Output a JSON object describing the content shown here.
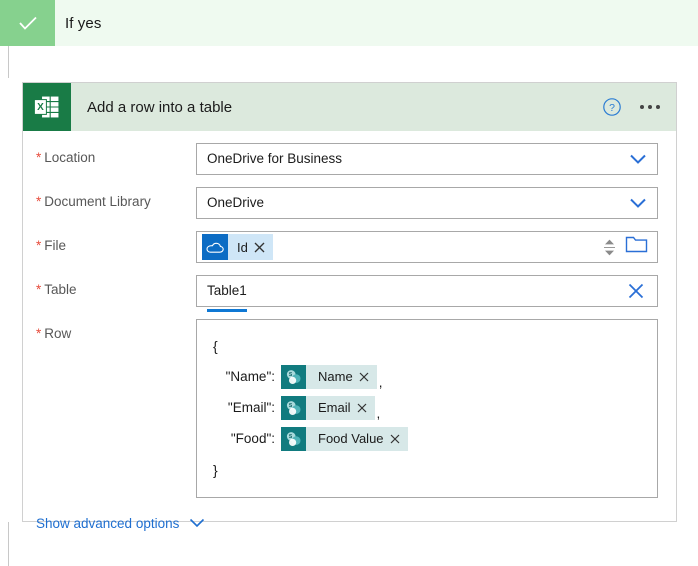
{
  "branch": {
    "title": "If yes",
    "check_icon": "checkmark-icon",
    "bar_color": "#effaf0",
    "check_bg": "#86d18e"
  },
  "card": {
    "title": "Add a row into a table",
    "app_icon": "excel-icon",
    "header_bg": "#dce9dd",
    "icon_bg": "#197b46",
    "help_icon": "help-circle-icon",
    "more_icon": "ellipsis-icon"
  },
  "fields": {
    "location": {
      "label": "Location",
      "required_marker": "*",
      "value": "OneDrive for Business",
      "control": "dropdown",
      "chevron_icon": "chevron-down-icon"
    },
    "document_library": {
      "label": "Document Library",
      "required_marker": "*",
      "value": "OneDrive",
      "control": "dropdown",
      "chevron_icon": "chevron-down-icon"
    },
    "file": {
      "label": "File",
      "required_marker": "*",
      "token": {
        "icon": "onedrive-cloud-icon",
        "label": "Id",
        "remove_icon": "close-x-icon",
        "icon_bg": "#0c6cc4",
        "token_bg": "#cfe6f7"
      },
      "spinner_icon": "up-down-spinner-icon",
      "picker_icon": "folder-icon"
    },
    "table": {
      "label": "Table",
      "required_marker": "*",
      "value": "Table1",
      "clear_icon": "clear-x-icon",
      "underline_color": "#0f78d4"
    },
    "row": {
      "label": "Row",
      "required_marker": "*",
      "open_brace": "{",
      "close_brace": "}",
      "entries": [
        {
          "key": "\"Name\":",
          "token_icon": "sharepoint-icon",
          "token_label": "Name",
          "remove_icon": "close-x-icon",
          "trailing": ","
        },
        {
          "key": "\"Email\":",
          "token_icon": "sharepoint-icon",
          "token_label": "Email",
          "remove_icon": "close-x-icon",
          "trailing": ","
        },
        {
          "key": "\"Food\":",
          "token_icon": "sharepoint-icon",
          "token_label": "Food Value",
          "remove_icon": "close-x-icon",
          "trailing": ""
        }
      ],
      "token_icon_bg": "#117b7f",
      "token_bg": "#d7e8e8"
    }
  },
  "advanced": {
    "label": "Show advanced options",
    "chevron_icon": "chevron-down-icon",
    "color": "#1f6fd0"
  }
}
